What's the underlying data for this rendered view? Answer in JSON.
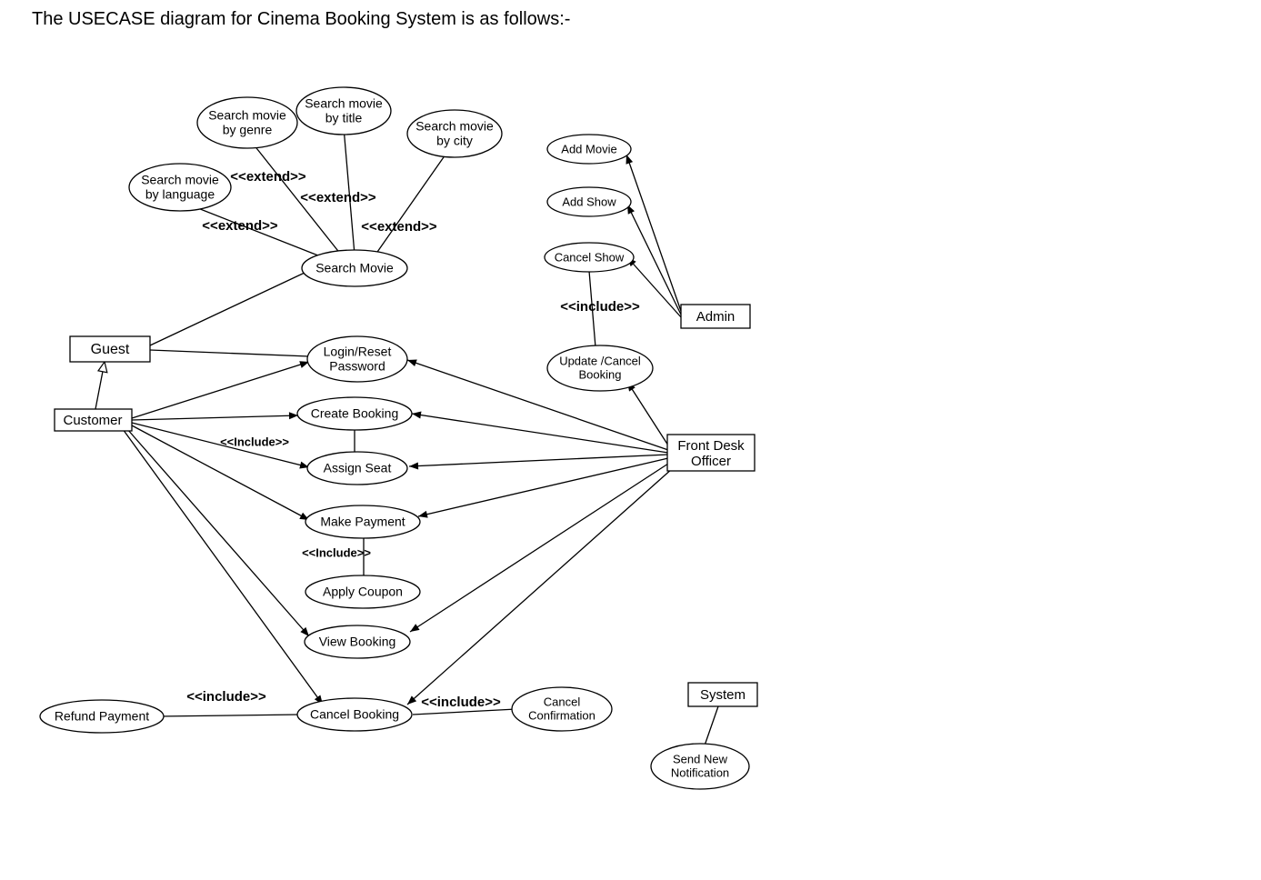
{
  "title": "The USECASE diagram for Cinema Booking System is as follows:-",
  "actors": {
    "guest": "Guest",
    "customer": "Customer",
    "frontDesk1": "Front Desk",
    "frontDesk2": "Officer",
    "admin": "Admin",
    "system": "System"
  },
  "usecases": {
    "searchMovie": "Search Movie",
    "searchByGenre1": "Search movie",
    "searchByGenre2": "by genre",
    "searchByTitle1": "Search movie",
    "searchByTitle2": "by title",
    "searchByCity1": "Search movie",
    "searchByCity2": "by city",
    "searchByLang1": "Search movie",
    "searchByLang2": "by language",
    "login1": "Login/Reset",
    "login2": "Password",
    "createBooking": "Create Booking",
    "assignSeat": "Assign Seat",
    "makePayment": "Make Payment",
    "applyCoupon": "Apply Coupon",
    "viewBooking": "View Booking",
    "cancelBooking": "Cancel Booking",
    "refundPayment": "Refund Payment",
    "cancelConfirm1": "Cancel",
    "cancelConfirm2": "Confirmation",
    "addMovie": "Add Movie",
    "addShow": "Add Show",
    "cancelShow": "Cancel Show",
    "updateCancel1": "Update /Cancel",
    "updateCancel2": "Booking",
    "sendNotif1": "Send New",
    "sendNotif2": "Notification"
  },
  "stereotypes": {
    "extend": "<<extend>>",
    "includeCap": "<<Include>>",
    "includeLow": "<<include>>"
  }
}
